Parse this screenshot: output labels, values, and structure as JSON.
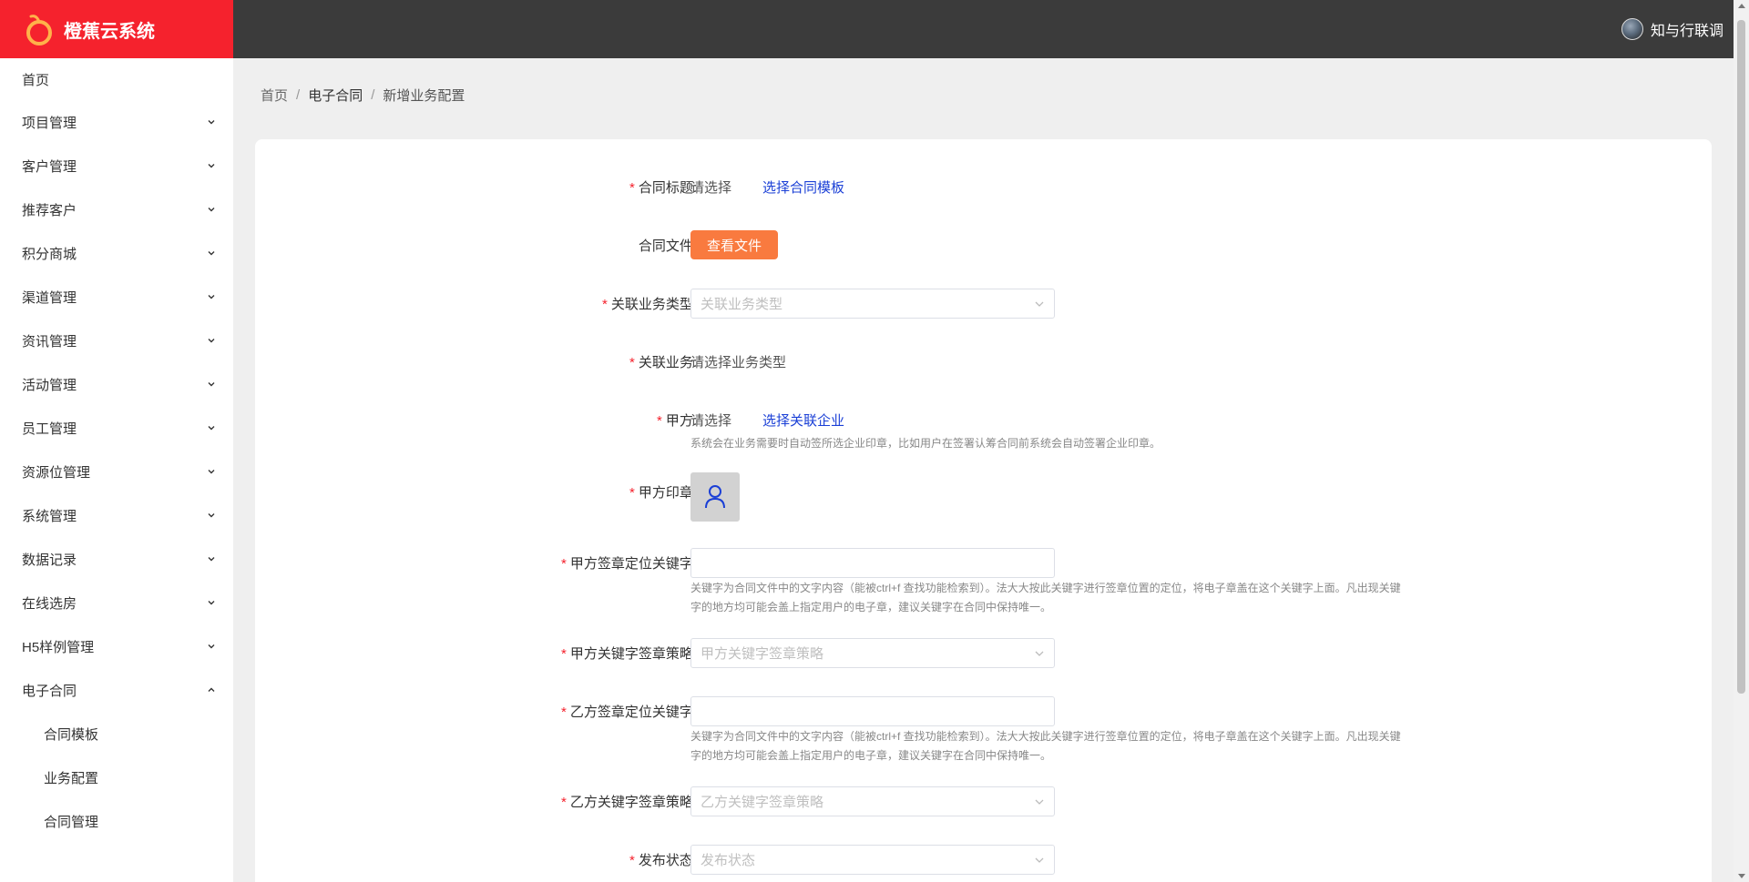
{
  "app": {
    "title": "橙蕉云系统",
    "user": "知与行联调"
  },
  "sidebar": {
    "home": "首页",
    "items": [
      {
        "label": "项目管理"
      },
      {
        "label": "客户管理"
      },
      {
        "label": "推荐客户"
      },
      {
        "label": "积分商城"
      },
      {
        "label": "渠道管理"
      },
      {
        "label": "资讯管理"
      },
      {
        "label": "活动管理"
      },
      {
        "label": "员工管理"
      },
      {
        "label": "资源位管理"
      },
      {
        "label": "系统管理"
      },
      {
        "label": "数据记录"
      },
      {
        "label": "在线选房"
      },
      {
        "label": "H5样例管理"
      }
    ],
    "expanded": {
      "label": "电子合同",
      "children": [
        "合同模板",
        "业务配置",
        "合同管理"
      ]
    }
  },
  "breadcrumb": [
    "首页",
    "电子合同",
    "新增业务配置"
  ],
  "form": {
    "contract_title": {
      "label": "合同标题:",
      "value": "请选择",
      "link": "选择合同模板"
    },
    "contract_file": {
      "label": "合同文件:",
      "button": "查看文件"
    },
    "biz_type": {
      "label": "关联业务类型:",
      "placeholder": "关联业务类型"
    },
    "biz": {
      "label": "关联业务:",
      "value": "请选择业务类型"
    },
    "party_a": {
      "label": "甲方:",
      "value": "请选择",
      "link": "选择关联企业",
      "hint": "系统会在业务需要时自动签所选企业印章，比如用户在签署认筹合同前系统会自动签署企业印章。"
    },
    "party_a_seal": {
      "label": "甲方印章:"
    },
    "party_a_keyword": {
      "label": "甲方签章定位关键字:",
      "value": "",
      "hint": "关键字为合同文件中的文字内容（能被ctrl+f 查找功能检索到）。法大大按此关键字进行签章位置的定位，将电子章盖在这个关键字上面。凡出现关键字的地方均可能会盖上指定用户的电子章，建议关键字在合同中保持唯一。"
    },
    "party_a_strategy": {
      "label": "甲方关键字签章策略:",
      "placeholder": "甲方关键字签章策略"
    },
    "party_b_keyword": {
      "label": "乙方签章定位关键字:",
      "value": "",
      "hint": "关键字为合同文件中的文字内容（能被ctrl+f 查找功能检索到）。法大大按此关键字进行签章位置的定位，将电子章盖在这个关键字上面。凡出现关键字的地方均可能会盖上指定用户的电子章，建议关键字在合同中保持唯一。"
    },
    "party_b_strategy": {
      "label": "乙方关键字签章策略:",
      "placeholder": "乙方关键字签章策略"
    },
    "publish_status": {
      "label": "发布状态:",
      "placeholder": "发布状态"
    }
  },
  "colors": {
    "brand": "#f5222d",
    "topbar": "#3b3b3b",
    "accent_button": "#f97a3f",
    "link": "#1a3fd6"
  },
  "icons": {
    "logo": "orange-logo-icon",
    "seal": "user-icon",
    "select": "chevron-down-icon"
  }
}
